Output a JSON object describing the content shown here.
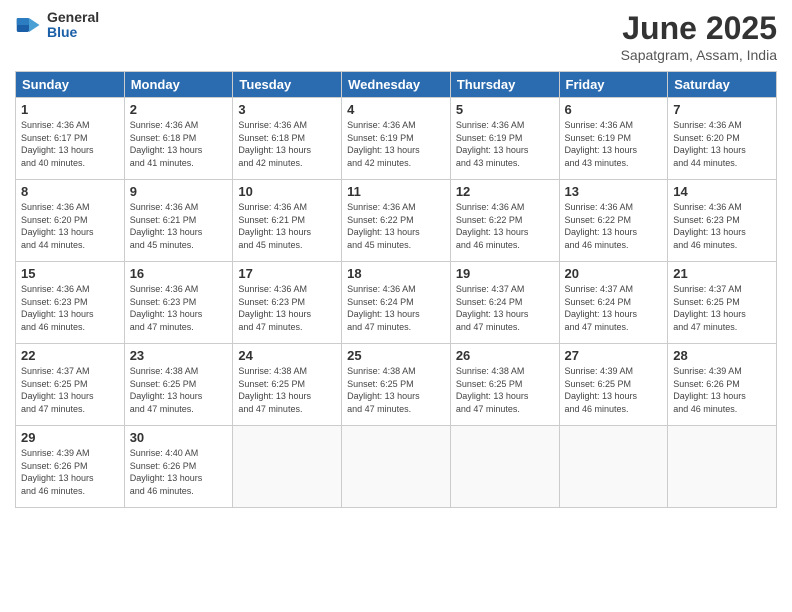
{
  "logo": {
    "general": "General",
    "blue": "Blue"
  },
  "title": "June 2025",
  "location": "Sapatgram, Assam, India",
  "headers": [
    "Sunday",
    "Monday",
    "Tuesday",
    "Wednesday",
    "Thursday",
    "Friday",
    "Saturday"
  ],
  "weeks": [
    [
      {
        "day": "1",
        "info": "Sunrise: 4:36 AM\nSunset: 6:17 PM\nDaylight: 13 hours\nand 40 minutes."
      },
      {
        "day": "2",
        "info": "Sunrise: 4:36 AM\nSunset: 6:18 PM\nDaylight: 13 hours\nand 41 minutes."
      },
      {
        "day": "3",
        "info": "Sunrise: 4:36 AM\nSunset: 6:18 PM\nDaylight: 13 hours\nand 42 minutes."
      },
      {
        "day": "4",
        "info": "Sunrise: 4:36 AM\nSunset: 6:19 PM\nDaylight: 13 hours\nand 42 minutes."
      },
      {
        "day": "5",
        "info": "Sunrise: 4:36 AM\nSunset: 6:19 PM\nDaylight: 13 hours\nand 43 minutes."
      },
      {
        "day": "6",
        "info": "Sunrise: 4:36 AM\nSunset: 6:19 PM\nDaylight: 13 hours\nand 43 minutes."
      },
      {
        "day": "7",
        "info": "Sunrise: 4:36 AM\nSunset: 6:20 PM\nDaylight: 13 hours\nand 44 minutes."
      }
    ],
    [
      {
        "day": "8",
        "info": "Sunrise: 4:36 AM\nSunset: 6:20 PM\nDaylight: 13 hours\nand 44 minutes."
      },
      {
        "day": "9",
        "info": "Sunrise: 4:36 AM\nSunset: 6:21 PM\nDaylight: 13 hours\nand 45 minutes."
      },
      {
        "day": "10",
        "info": "Sunrise: 4:36 AM\nSunset: 6:21 PM\nDaylight: 13 hours\nand 45 minutes."
      },
      {
        "day": "11",
        "info": "Sunrise: 4:36 AM\nSunset: 6:22 PM\nDaylight: 13 hours\nand 45 minutes."
      },
      {
        "day": "12",
        "info": "Sunrise: 4:36 AM\nSunset: 6:22 PM\nDaylight: 13 hours\nand 46 minutes."
      },
      {
        "day": "13",
        "info": "Sunrise: 4:36 AM\nSunset: 6:22 PM\nDaylight: 13 hours\nand 46 minutes."
      },
      {
        "day": "14",
        "info": "Sunrise: 4:36 AM\nSunset: 6:23 PM\nDaylight: 13 hours\nand 46 minutes."
      }
    ],
    [
      {
        "day": "15",
        "info": "Sunrise: 4:36 AM\nSunset: 6:23 PM\nDaylight: 13 hours\nand 46 minutes."
      },
      {
        "day": "16",
        "info": "Sunrise: 4:36 AM\nSunset: 6:23 PM\nDaylight: 13 hours\nand 47 minutes."
      },
      {
        "day": "17",
        "info": "Sunrise: 4:36 AM\nSunset: 6:23 PM\nDaylight: 13 hours\nand 47 minutes."
      },
      {
        "day": "18",
        "info": "Sunrise: 4:36 AM\nSunset: 6:24 PM\nDaylight: 13 hours\nand 47 minutes."
      },
      {
        "day": "19",
        "info": "Sunrise: 4:37 AM\nSunset: 6:24 PM\nDaylight: 13 hours\nand 47 minutes."
      },
      {
        "day": "20",
        "info": "Sunrise: 4:37 AM\nSunset: 6:24 PM\nDaylight: 13 hours\nand 47 minutes."
      },
      {
        "day": "21",
        "info": "Sunrise: 4:37 AM\nSunset: 6:25 PM\nDaylight: 13 hours\nand 47 minutes."
      }
    ],
    [
      {
        "day": "22",
        "info": "Sunrise: 4:37 AM\nSunset: 6:25 PM\nDaylight: 13 hours\nand 47 minutes."
      },
      {
        "day": "23",
        "info": "Sunrise: 4:38 AM\nSunset: 6:25 PM\nDaylight: 13 hours\nand 47 minutes."
      },
      {
        "day": "24",
        "info": "Sunrise: 4:38 AM\nSunset: 6:25 PM\nDaylight: 13 hours\nand 47 minutes."
      },
      {
        "day": "25",
        "info": "Sunrise: 4:38 AM\nSunset: 6:25 PM\nDaylight: 13 hours\nand 47 minutes."
      },
      {
        "day": "26",
        "info": "Sunrise: 4:38 AM\nSunset: 6:25 PM\nDaylight: 13 hours\nand 47 minutes."
      },
      {
        "day": "27",
        "info": "Sunrise: 4:39 AM\nSunset: 6:25 PM\nDaylight: 13 hours\nand 46 minutes."
      },
      {
        "day": "28",
        "info": "Sunrise: 4:39 AM\nSunset: 6:26 PM\nDaylight: 13 hours\nand 46 minutes."
      }
    ],
    [
      {
        "day": "29",
        "info": "Sunrise: 4:39 AM\nSunset: 6:26 PM\nDaylight: 13 hours\nand 46 minutes."
      },
      {
        "day": "30",
        "info": "Sunrise: 4:40 AM\nSunset: 6:26 PM\nDaylight: 13 hours\nand 46 minutes."
      },
      null,
      null,
      null,
      null,
      null
    ]
  ]
}
